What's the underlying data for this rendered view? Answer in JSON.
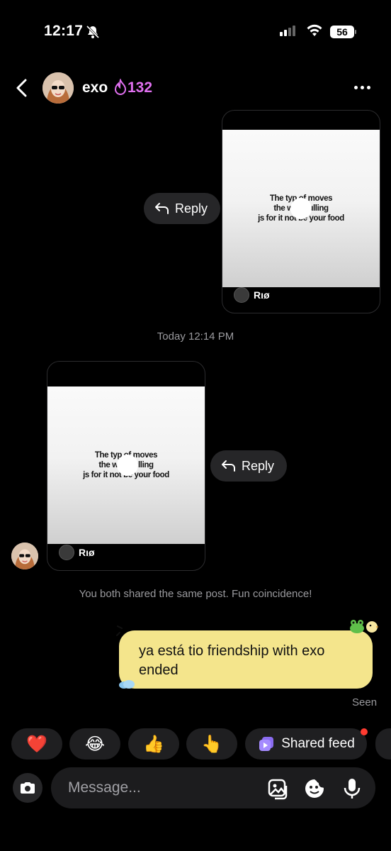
{
  "status_bar": {
    "time": "12:17",
    "battery": "56"
  },
  "header": {
    "name": "exo",
    "streak": "132"
  },
  "posts": [
    {
      "caption_lines": [
        "The typ  of moves",
        "the wait    pulling",
        "js for it not   be your food"
      ],
      "author": "Rıø",
      "reply_label": "Reply"
    },
    {
      "caption_lines": [
        "The typ  of moves",
        "the wait    pulling",
        "js for it not   be your food"
      ],
      "author": "Rıø",
      "reply_label": "Reply"
    }
  ],
  "date_separator": "Today 12:14 PM",
  "coincidence_text": "You both shared the same post. Fun coincidence!",
  "message": {
    "text": "ya está tio friendship with exo ended",
    "status": "Seen"
  },
  "reactions": [
    {
      "emoji": "❤️",
      "icon": "heart-icon"
    },
    {
      "emoji": "😂",
      "icon": "laughing-face-icon"
    },
    {
      "emoji": "👍",
      "icon": "thumbs-up-icon"
    },
    {
      "emoji": "👆",
      "icon": "pointing-up-icon"
    }
  ],
  "shared_feed_label": "Shared feed",
  "composer": {
    "placeholder": "Message..."
  }
}
